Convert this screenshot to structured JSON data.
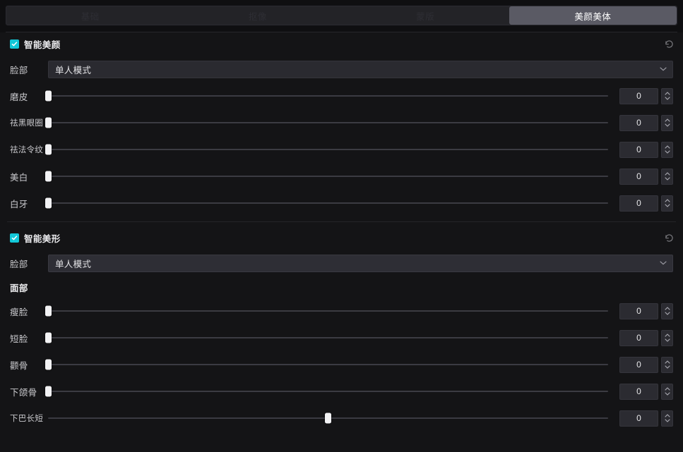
{
  "tabs": [
    {
      "label": "基础",
      "active": false
    },
    {
      "label": "抠像",
      "active": false
    },
    {
      "label": "蒙版",
      "active": false
    },
    {
      "label": "美颜美体",
      "active": true
    }
  ],
  "sections": [
    {
      "id": "smart-beauty",
      "title": "智能美颜",
      "checked": true,
      "reset_icon": "reset-icon",
      "select": {
        "label": "脸部",
        "value": "单人模式",
        "caret_icon": "chevron-down-icon"
      },
      "sliders": [
        {
          "label": "磨皮",
          "value": "0",
          "percent": 0
        },
        {
          "label": "祛黑眼圈",
          "value": "0",
          "percent": 0
        },
        {
          "label": "祛法令纹",
          "value": "0",
          "percent": 0
        },
        {
          "label": "美白",
          "value": "0",
          "percent": 0
        },
        {
          "label": "白牙",
          "value": "0",
          "percent": 0
        }
      ]
    },
    {
      "id": "smart-shape",
      "title": "智能美形",
      "checked": true,
      "reset_icon": "reset-icon",
      "select": {
        "label": "脸部",
        "value": "单人模式",
        "caret_icon": "chevron-down-icon"
      },
      "subhead": "面部",
      "sliders": [
        {
          "label": "瘦脸",
          "value": "0",
          "percent": 0
        },
        {
          "label": "短脸",
          "value": "0",
          "percent": 0
        },
        {
          "label": "颧骨",
          "value": "0",
          "percent": 0
        },
        {
          "label": "下颌骨",
          "value": "0",
          "percent": 0
        },
        {
          "label": "下巴长短",
          "value": "0",
          "percent": 50
        }
      ]
    }
  ],
  "colors": {
    "accent": "#12c8d8",
    "active_tab_bg": "#5a5a64",
    "panel_bg": "#141416",
    "thumb": "#f2f2f4"
  }
}
